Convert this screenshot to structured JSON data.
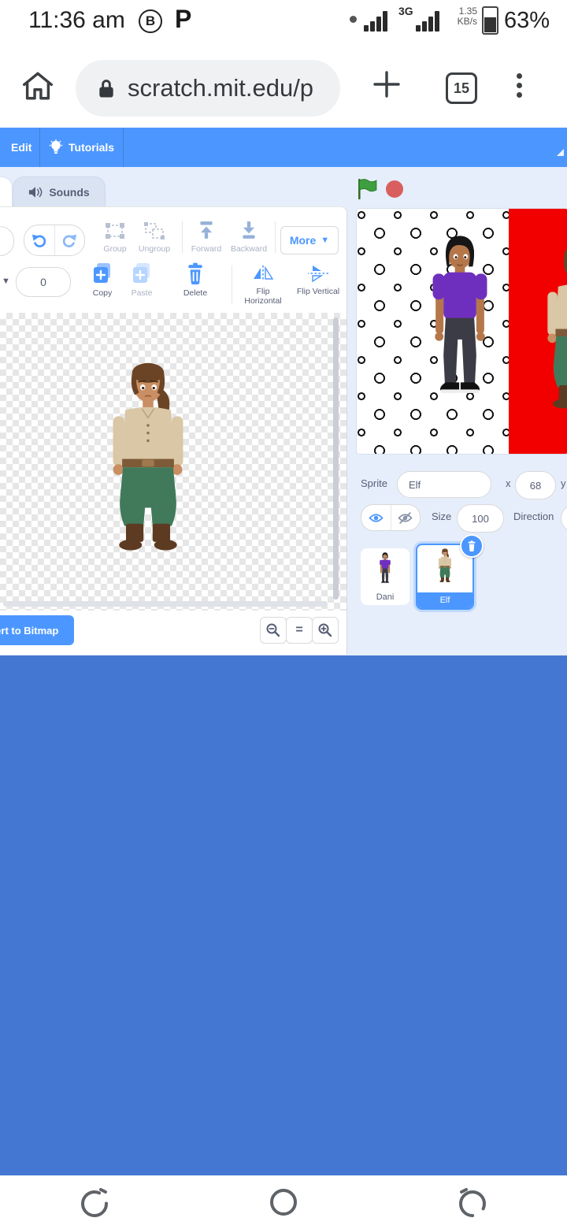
{
  "status_bar": {
    "time": "11:36 am",
    "notif_b": "B",
    "notif_p": "P",
    "network": "3G",
    "speed_value": "1.35",
    "speed_unit": "KB/s",
    "battery": "63%"
  },
  "browser": {
    "url": "scratch.mit.edu/p",
    "tab_count": "15"
  },
  "menu_bar": {
    "edit": "Edit",
    "tutorials": "Tutorials"
  },
  "tabs": {
    "sounds": "Sounds"
  },
  "toolbar": {
    "group": "Group",
    "ungroup": "Ungroup",
    "forward": "Forward",
    "backward": "Backward",
    "more": "More",
    "stroke_width": "0",
    "copy": "Copy",
    "paste": "Paste",
    "delete": "Delete",
    "flip_horizontal": "Flip Horizontal",
    "flip_vertical": "Flip Vertical"
  },
  "canvas_bar": {
    "convert_to_bitmap": "Convert to Bitmap",
    "zoom_reset": "="
  },
  "sprite_panel": {
    "sprite_label": "Sprite",
    "name": "Elf",
    "x_label": "x",
    "x_value": "68",
    "y_label": "y",
    "size_label": "Size",
    "size_value": "100",
    "direction_label": "Direction"
  },
  "sprites": [
    {
      "name": "Dani"
    },
    {
      "name": "Elf"
    }
  ],
  "colors": {
    "accent_blue": "#4c97ff",
    "stage_red": "#f20000",
    "page_blue": "#4477d1",
    "inactive_tab": "#d9e3f2"
  }
}
